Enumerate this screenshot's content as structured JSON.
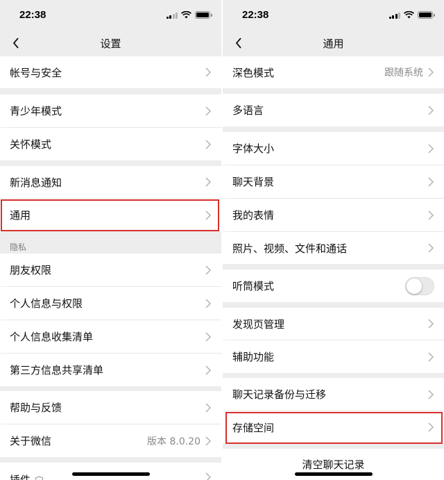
{
  "colors": {
    "background": "#ededed",
    "row": "#ffffff",
    "highlight": "#d9302c",
    "secondary_text": "#8a8a8a"
  },
  "left": {
    "status": {
      "time": "22:38"
    },
    "title": "设置",
    "account_security": "帐号与安全",
    "teen_mode": "青少年模式",
    "care_mode": "关怀模式",
    "new_message": "新消息通知",
    "general": "通用",
    "privacy_section": "隐私",
    "friend_permissions": "朋友权限",
    "personal_info": "个人信息与权限",
    "info_collection": "个人信息收集清单",
    "third_party": "第三方信息共享清单",
    "help_feedback": "帮助与反馈",
    "about_wechat": "关于微信",
    "version": "版本 8.0.20",
    "plugins": "插件"
  },
  "right": {
    "status": {
      "time": "22:38"
    },
    "title": "通用",
    "dark_mode": "深色模式",
    "dark_mode_value": "跟随系统",
    "language": "多语言",
    "font_size": "字体大小",
    "chat_background": "聊天背景",
    "my_stickers": "我的表情",
    "media_files": "照片、视频、文件和通话",
    "earpiece_mode": "听筒模式",
    "earpiece_mode_on": false,
    "discover_manage": "发现页管理",
    "accessibility": "辅助功能",
    "chat_backup": "聊天记录备份与迁移",
    "storage": "存储空间",
    "clear_chat": "清空聊天记录"
  }
}
